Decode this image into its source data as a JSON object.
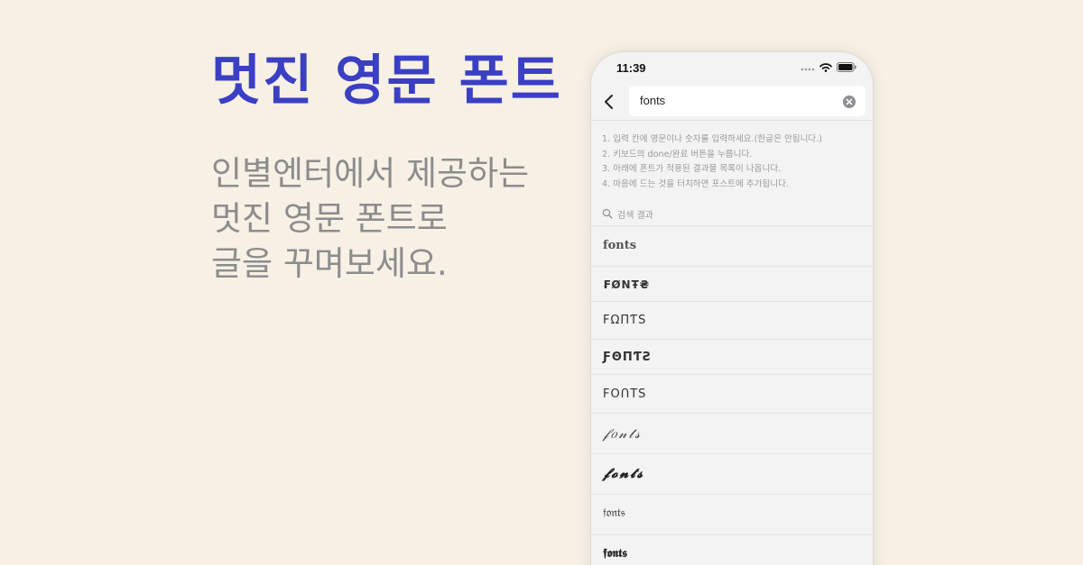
{
  "banner": {
    "headline": "멋진 영문 폰트",
    "subtitle_lines": [
      "인별엔터에서 제공하는",
      "멋진 영문 폰트로",
      "글을 꾸며보세요."
    ]
  },
  "phone": {
    "status_time": "11:39",
    "search": {
      "value": "fonts"
    },
    "instructions": [
      "1. 입력 칸에 영문이나 숫자를 입력하세요.(한글은 안됩니다.)",
      "2. 키보드의 done/완료 버튼을 누릅니다.",
      "3. 아래에 폰트가 적용된 결과물 목록이 나옵니다.",
      "4. 마음에 드는 것을 터치하면 포스트에 추가됩니다."
    ],
    "results_label": "검색 결과",
    "results": [
      "fonts",
      "₣ØΝŦ₴",
      "ϜΩΠƬЅ",
      "ƑΘΠƬƧ",
      "FOՈTS",
      "𝒻𝑜𝓃𝓉𝓈",
      "𝓯𝓸𝓷𝓽𝓼",
      "𝔣𝔬𝔫𝔱𝔰",
      "𝖋𝖔𝖓𝖙𝖘"
    ]
  },
  "colors": {
    "background": "#f6f0e5",
    "headline": "#3b3fc4",
    "subtitle": "#8c8c8c"
  },
  "icons": [
    "signal-icon",
    "wifi-icon",
    "battery-icon",
    "back-chevron-icon",
    "clear-icon",
    "search-icon"
  ]
}
